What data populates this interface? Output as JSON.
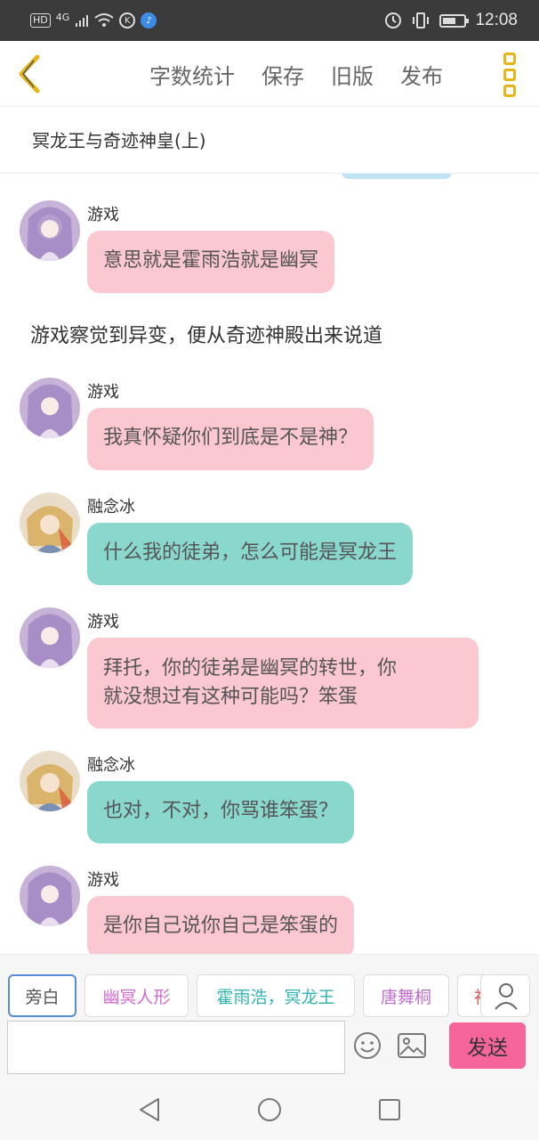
{
  "status_bar": {
    "hd": "HD",
    "network": "4G",
    "time": "12:08"
  },
  "nav": {
    "items": [
      {
        "label": "字数统计"
      },
      {
        "label": "保存"
      },
      {
        "label": "旧版"
      },
      {
        "label": "发布"
      }
    ]
  },
  "chapter": {
    "title": "冥龙王与奇迹神皇(上)"
  },
  "chat": {
    "messages": [
      {
        "type": "message",
        "speaker": "游戏",
        "text": "意思就是霍雨浩就是幽冥",
        "style": "pink"
      },
      {
        "type": "narration",
        "text": "游戏察觉到异变，便从奇迹神殿出来说道"
      },
      {
        "type": "message",
        "speaker": "游戏",
        "text": "我真怀疑你们到底是不是神？",
        "style": "pink"
      },
      {
        "type": "message",
        "speaker": "融念冰",
        "text": "什么我的徒弟，怎么可能是冥龙王",
        "style": "teal"
      },
      {
        "type": "message",
        "speaker": "游戏",
        "text_line1": "拜托，你的徒弟是幽冥的转世，你",
        "text_line2": "就没想过有这种可能吗？笨蛋",
        "style": "pink"
      },
      {
        "type": "message",
        "speaker": "融念冰",
        "text": "也对，不对，你骂谁笨蛋？",
        "style": "teal"
      },
      {
        "type": "message",
        "speaker": "游戏",
        "text": "是你自己说你自己是笨蛋的",
        "style": "pink"
      }
    ]
  },
  "characters": [
    {
      "label": "旁白",
      "color": "#555555"
    },
    {
      "label": "幽冥人形",
      "color": "#d66ad6"
    },
    {
      "label": "霍雨浩，冥龙王",
      "color": "#2fb3b3"
    },
    {
      "label": "唐舞桐",
      "color": "#c06fcf"
    },
    {
      "label": "神",
      "color": "#e05050"
    }
  ],
  "composer": {
    "input_value": "",
    "send_label": "发送"
  },
  "colors": {
    "accent": "#e5b51a",
    "pink_bubble": "#fbc8d2",
    "teal_bubble": "#8ad7cd",
    "send_button": "#f5649b"
  }
}
